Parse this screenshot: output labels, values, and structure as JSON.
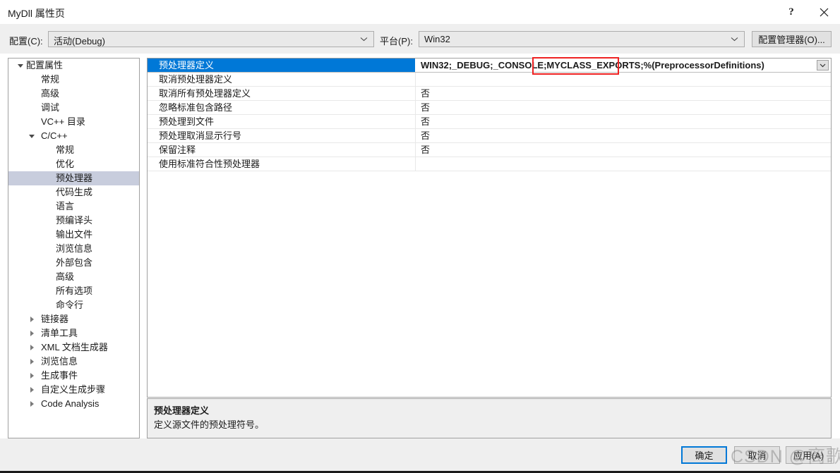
{
  "window": {
    "title": "MyDll 属性页",
    "buttons": {
      "help": "?",
      "help_icon": "question-mark-icon",
      "close_icon": "close-icon"
    }
  },
  "configbar": {
    "config_label": "配置(C):",
    "config_value": "活动(Debug)",
    "platform_label": "平台(P):",
    "platform_value": "Win32",
    "config_manager_button": "配置管理器(O)..."
  },
  "tree": {
    "items": [
      {
        "label": "配置属性",
        "indent": 0,
        "expander": "down",
        "selected": false
      },
      {
        "label": "常规",
        "indent": 1,
        "expander": "none",
        "selected": false
      },
      {
        "label": "高级",
        "indent": 1,
        "expander": "none",
        "selected": false
      },
      {
        "label": "调试",
        "indent": 1,
        "expander": "none",
        "selected": false
      },
      {
        "label": "VC++ 目录",
        "indent": 1,
        "expander": "none",
        "selected": false
      },
      {
        "label": "C/C++",
        "indent": 1,
        "expander": "down",
        "selected": false
      },
      {
        "label": "常规",
        "indent": 2,
        "expander": "none",
        "selected": false
      },
      {
        "label": "优化",
        "indent": 2,
        "expander": "none",
        "selected": false
      },
      {
        "label": "预处理器",
        "indent": 2,
        "expander": "none",
        "selected": true
      },
      {
        "label": "代码生成",
        "indent": 2,
        "expander": "none",
        "selected": false
      },
      {
        "label": "语言",
        "indent": 2,
        "expander": "none",
        "selected": false
      },
      {
        "label": "预编译头",
        "indent": 2,
        "expander": "none",
        "selected": false
      },
      {
        "label": "输出文件",
        "indent": 2,
        "expander": "none",
        "selected": false
      },
      {
        "label": "浏览信息",
        "indent": 2,
        "expander": "none",
        "selected": false
      },
      {
        "label": "外部包含",
        "indent": 2,
        "expander": "none",
        "selected": false
      },
      {
        "label": "高级",
        "indent": 2,
        "expander": "none",
        "selected": false
      },
      {
        "label": "所有选项",
        "indent": 2,
        "expander": "none",
        "selected": false
      },
      {
        "label": "命令行",
        "indent": 2,
        "expander": "none",
        "selected": false
      },
      {
        "label": "链接器",
        "indent": 1,
        "expander": "right",
        "selected": false
      },
      {
        "label": "清单工具",
        "indent": 1,
        "expander": "right",
        "selected": false
      },
      {
        "label": "XML 文档生成器",
        "indent": 1,
        "expander": "right",
        "selected": false
      },
      {
        "label": "浏览信息",
        "indent": 1,
        "expander": "right",
        "selected": false
      },
      {
        "label": "生成事件",
        "indent": 1,
        "expander": "right",
        "selected": false
      },
      {
        "label": "自定义生成步骤",
        "indent": 1,
        "expander": "right",
        "selected": false
      },
      {
        "label": "Code Analysis",
        "indent": 1,
        "expander": "right",
        "selected": false
      }
    ]
  },
  "grid": {
    "rows": [
      {
        "name": "预处理器定义",
        "value": "WIN32;_DEBUG;_CONSOLE;MYCLASS_EXPORTS;%(PreprocessorDefinitions)",
        "selected": true,
        "dropdown": true
      },
      {
        "name": "取消预处理器定义",
        "value": "",
        "selected": false,
        "dropdown": false
      },
      {
        "name": "取消所有预处理器定义",
        "value": "否",
        "selected": false,
        "dropdown": false
      },
      {
        "name": "忽略标准包含路径",
        "value": "否",
        "selected": false,
        "dropdown": false
      },
      {
        "name": "预处理到文件",
        "value": "否",
        "selected": false,
        "dropdown": false
      },
      {
        "name": "预处理取消显示行号",
        "value": "否",
        "selected": false,
        "dropdown": false
      },
      {
        "name": "保留注释",
        "value": "否",
        "selected": false,
        "dropdown": false
      },
      {
        "name": "使用标准符合性预处理器",
        "value": "",
        "selected": false,
        "dropdown": false
      }
    ]
  },
  "description": {
    "title": "预处理器定义",
    "body": "定义源文件的预处理符号。"
  },
  "footer": {
    "ok": "确定",
    "cancel": "取消",
    "apply": "应用(A)"
  },
  "annotation": {
    "highlight_text": "MYCLASS_EXPORTS;",
    "color": "#ee2222"
  },
  "watermark": {
    "text": "CSDN @离歌漠"
  }
}
